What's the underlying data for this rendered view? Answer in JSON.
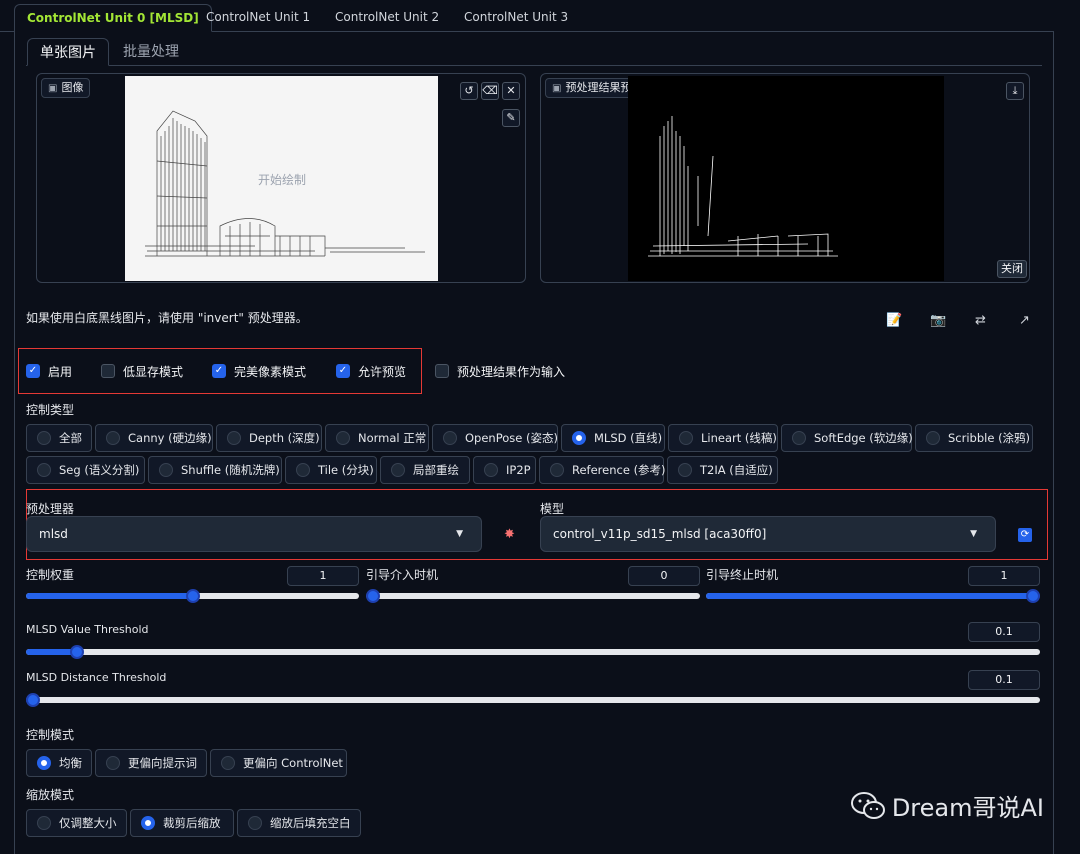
{
  "tabs": [
    "ControlNet Unit 0 [MLSD]",
    "ControlNet Unit 1",
    "ControlNet Unit 2",
    "ControlNet Unit 3"
  ],
  "subtabs": [
    "单张图片",
    "批量处理"
  ],
  "image_panel": {
    "label": "图像",
    "placeholder": "开始绘制"
  },
  "preview_panel": {
    "label": "预处理结果预览",
    "close_label": "关闭"
  },
  "hint": "如果使用白底黑线图片，请使用 \"invert\" 预处理器。",
  "checkboxes": [
    {
      "label": "启用",
      "checked": true
    },
    {
      "label": "低显存模式",
      "checked": false
    },
    {
      "label": "完美像素模式",
      "checked": true
    },
    {
      "label": "允许预览",
      "checked": true
    },
    {
      "label": "预处理结果作为输入",
      "checked": false
    }
  ],
  "control_type": {
    "label": "控制类型",
    "options": [
      "全部",
      "Canny (硬边缘)",
      "Depth (深度)",
      "Normal 正常",
      "OpenPose (姿态)",
      "MLSD (直线)",
      "Lineart (线稿)",
      "SoftEdge (软边缘)",
      "Scribble (涂鸦)",
      "Seg (语义分割)",
      "Shuffle (随机洗牌)",
      "Tile (分块)",
      "局部重绘",
      "IP2P",
      "Reference (参考)",
      "T2IA (自适应)"
    ],
    "selected": "MLSD (直线)"
  },
  "preprocessor": {
    "label": "预处理器",
    "value": "mlsd"
  },
  "model": {
    "label": "模型",
    "value": "control_v11p_sd15_mlsd [aca30ff0]"
  },
  "sliders": {
    "weight": {
      "label": "控制权重",
      "value": "1",
      "fraction": 0.5
    },
    "start": {
      "label": "引导介入时机",
      "value": "0",
      "fraction": 0.0
    },
    "end": {
      "label": "引导终止时机",
      "value": "1",
      "fraction": 1.0
    },
    "mlsd_value": {
      "label": "MLSD Value Threshold",
      "value": "0.1",
      "fraction": 0.05
    },
    "mlsd_distance": {
      "label": "MLSD Distance Threshold",
      "value": "0.1",
      "fraction": 0.005
    }
  },
  "control_mode": {
    "label": "控制模式",
    "options": [
      "均衡",
      "更偏向提示词",
      "更偏向 ControlNet"
    ],
    "selected": "均衡"
  },
  "resize_mode": {
    "label": "缩放模式",
    "options": [
      "仅调整大小",
      "裁剪后缩放",
      "缩放后填充空白"
    ],
    "selected": "裁剪后缩放"
  },
  "watermark": "Dream哥说AI",
  "colors": {
    "accent": "#2563eb",
    "active_tab": "#a3e635",
    "highlight_box": "#e53935"
  }
}
